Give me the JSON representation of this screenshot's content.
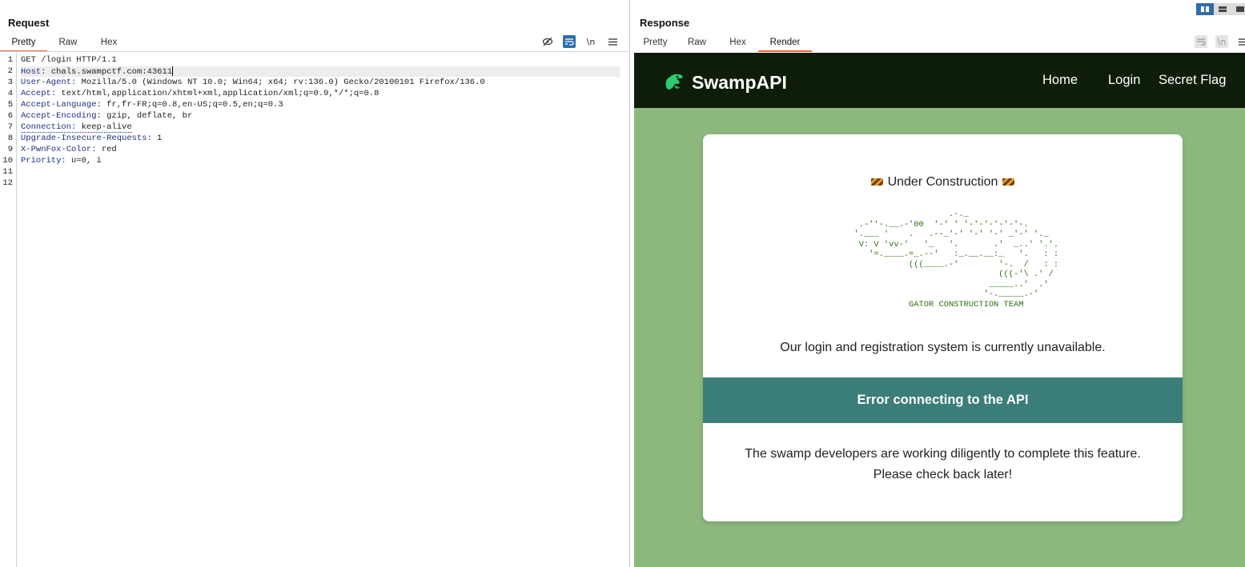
{
  "request": {
    "title": "Request",
    "tabs": [
      "Pretty",
      "Raw",
      "Hex"
    ],
    "active_tab": "Pretty",
    "toolbar_icons": [
      "hide-icon",
      "wrap-toggle-icon",
      "newline-icon",
      "menu-icon"
    ],
    "newline_label": "\\n",
    "line_numbers": [
      "1",
      "2",
      "3",
      "4",
      "5",
      "6",
      "7",
      "8",
      "9",
      "10",
      "11",
      "12"
    ],
    "lines": [
      {
        "key": "",
        "value": "GET /login HTTP/1.1"
      },
      {
        "key": "Host",
        "value": "chals.swampctf.com:43611"
      },
      {
        "key": "User-Agent",
        "value": "Mozilla/5.0 (Windows NT 10.0; Win64; x64; rv:136.0) Gecko/20100101 Firefox/136.0"
      },
      {
        "key": "Accept",
        "value": "text/html,application/xhtml+xml,application/xml;q=0.9,*/*;q=0.8"
      },
      {
        "key": "Accept-Language",
        "value": "fr,fr-FR;q=0.8,en-US;q=0.5,en;q=0.3"
      },
      {
        "key": "Accept-Encoding",
        "value": "gzip, deflate, br"
      },
      {
        "key": "Connection",
        "value": "keep-alive"
      },
      {
        "key": "Upgrade-Insecure-Requests",
        "value": "1"
      },
      {
        "key": "X-PwnFox-Color",
        "value": "red"
      },
      {
        "key": "Priority",
        "value": "u=0, i"
      }
    ]
  },
  "response": {
    "title": "Response",
    "tabs": [
      "Pretty",
      "Raw",
      "Hex",
      "Render"
    ],
    "active_tab": "Render",
    "toolbar_icons": [
      "wrap-toggle-icon",
      "newline-icon",
      "menu-icon"
    ],
    "newline_label": "\\n"
  },
  "layout_toggle": [
    "split-horizontal-icon",
    "split-vertical-icon",
    "single-pane-icon"
  ],
  "site": {
    "brand": "SwampAPI",
    "nav": [
      "Home",
      "Login",
      "Secret Flag"
    ],
    "under_construction": "Under Construction",
    "ascii_art": "                     .-._\n   .-''-.__.-'00  '-' ' '-'-'-'-'-'-.\n  '.___ '    .   .--_'-' '-' '-' _'-' '._\n   V: V 'vv-'   '_   '.       .'  _..' '.'.\n     '=.____.=_.--'   :_.__.__:_   '.   : :\n             (((____.-'        '-.  /   : :\n                               (((-'\\ .' /\n                             _____..'  .'\n                            '-._____.-'\n             GATOR CONSTRUCTION TEAM",
    "unavailable": "Our login and registration system is currently unavailable.",
    "error": "Error connecting to the API",
    "note_line1": "The swamp developers are working diligently to complete this feature.",
    "note_line2": "Please check back later!"
  },
  "colors": {
    "accent_tab": "#e8693a",
    "nav_bg": "#0e1d0a",
    "page_bg": "#8cb87e",
    "error_bar": "#3b7d79",
    "ascii_green": "#2d6e12",
    "header_key": "#1e2f80"
  }
}
